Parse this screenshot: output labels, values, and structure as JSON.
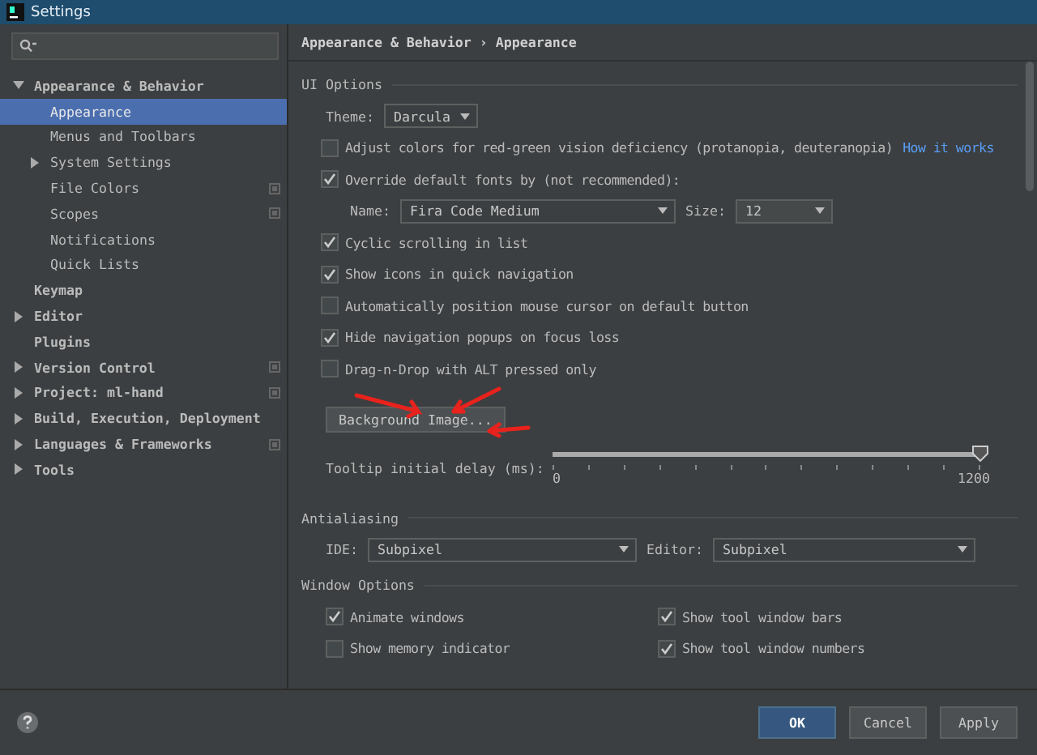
{
  "window": {
    "title": "Settings"
  },
  "sidebar": {
    "items": [
      {
        "label": "Appearance & Behavior",
        "expanded": true,
        "selected": false,
        "project_scope": false,
        "children": [
          {
            "label": "Appearance",
            "selected": true,
            "project_scope": false
          },
          {
            "label": "Menus and Toolbars",
            "selected": false,
            "project_scope": false
          },
          {
            "label": "System Settings",
            "expanded": false,
            "selected": false,
            "project_scope": false
          },
          {
            "label": "File Colors",
            "selected": false,
            "project_scope": true
          },
          {
            "label": "Scopes",
            "selected": false,
            "project_scope": true
          },
          {
            "label": "Notifications",
            "selected": false,
            "project_scope": false
          },
          {
            "label": "Quick Lists",
            "selected": false,
            "project_scope": false
          }
        ]
      },
      {
        "label": "Keymap",
        "selected": false,
        "project_scope": false
      },
      {
        "label": "Editor",
        "expanded": false,
        "selected": false,
        "project_scope": false
      },
      {
        "label": "Plugins",
        "selected": false,
        "project_scope": false
      },
      {
        "label": "Version Control",
        "expanded": false,
        "selected": false,
        "project_scope": true
      },
      {
        "label": "Project: ml-hand",
        "expanded": false,
        "selected": false,
        "project_scope": true
      },
      {
        "label": "Build, Execution, Deployment",
        "expanded": false,
        "selected": false,
        "project_scope": false
      },
      {
        "label": "Languages & Frameworks",
        "expanded": false,
        "selected": false,
        "project_scope": true
      },
      {
        "label": "Tools",
        "expanded": false,
        "selected": false,
        "project_scope": false
      }
    ]
  },
  "breadcrumb": [
    "Appearance & Behavior",
    "›",
    "Appearance"
  ],
  "ui_options": {
    "heading": "UI Options",
    "theme": {
      "label": "Theme:",
      "value": "Darcula"
    },
    "items": [
      {
        "kind": "checkbox",
        "label": "Adjust colors for red-green vision deficiency (protanopia, deuteranopia)",
        "checked": false,
        "link": "How it works"
      },
      {
        "kind": "checkbox",
        "label": "Override default fonts by (not recommended):",
        "checked": true
      },
      {
        "kind": "font",
        "name_label": "Name:",
        "name_value": "Fira Code Medium",
        "size_label": "Size:",
        "size_value": "12"
      },
      {
        "kind": "checkbox",
        "label": "Cyclic scrolling in list",
        "checked": true
      },
      {
        "kind": "checkbox",
        "label": "Show icons in quick navigation",
        "checked": true
      },
      {
        "kind": "checkbox",
        "label": "Automatically position mouse cursor on default button",
        "checked": false
      },
      {
        "kind": "checkbox",
        "label": "Hide navigation popups on focus loss",
        "checked": true
      },
      {
        "kind": "checkbox",
        "label": "Drag-n-Drop with ALT pressed only",
        "checked": false
      }
    ],
    "background_button": "Background Image...",
    "tooltip_delay": {
      "label": "Tooltip initial delay (ms):",
      "level": 1,
      "min_label": "0",
      "max_label": "1200"
    }
  },
  "annotations": [
    {
      "kind": "arrow"
    },
    {
      "kind": "arrow"
    },
    {
      "kind": "arrow"
    }
  ],
  "antialiasing": {
    "heading": "Antialiasing",
    "ide_label": "IDE:",
    "ide_value": "Subpixel",
    "editor_label": "Editor:",
    "editor_value": "Subpixel"
  },
  "window_options": {
    "heading": "Window Options",
    "items": [
      {
        "label": "Animate windows",
        "checked": true
      },
      {
        "label": "Show tool window bars",
        "checked": true
      },
      {
        "label": "Show memory indicator",
        "checked": false
      },
      {
        "label": "Show tool window numbers",
        "checked": true
      }
    ]
  },
  "buttons": [
    {
      "label": "OK",
      "default": true
    },
    {
      "label": "Cancel",
      "default": false
    },
    {
      "label": "Apply",
      "default": false
    }
  ]
}
